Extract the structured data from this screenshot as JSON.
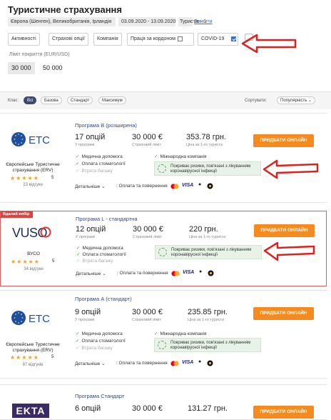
{
  "page": {
    "title": "Туристичне страхування"
  },
  "search": {
    "chips": [
      "Європа (Шенген), Великобританія, Ірландія",
      "03.09.2020 - 13.09.2020",
      "Туристів - 1"
    ],
    "change_label": "Змінити"
  },
  "filters": {
    "buttons": [
      "Активності",
      "Страхові опції",
      "Компанія"
    ],
    "checks": [
      {
        "label": "Праця за кордоном",
        "checked": false
      },
      {
        "label": "COVID-19",
        "checked": true
      }
    ]
  },
  "limit": {
    "label": "Ліміт покриття (EUR/USD)",
    "options": [
      "30 000",
      "50 000"
    ],
    "selected": "30 000"
  },
  "classbar": {
    "label": "Клас:",
    "pills": [
      "Всі",
      "Базова",
      "Стандарт",
      "Максимум"
    ],
    "sort_label": "Сортувати:",
    "sort_value": "Популярність"
  },
  "common": {
    "options_sub": "У програмі",
    "limit_sub": "Страховий ліміт",
    "price_sub": "Ціна за 1-го туриста",
    "buy_label": "ПРИДБАТИ ОНЛАЙН",
    "details_label": "Детальніше",
    "payment_label": "Оплата та повернення",
    "covid_text": "Покриває ризики, пов'язані з лікуванням коронавірусної інфекції",
    "badge": "Вдалий вибір"
  },
  "cards": [
    {
      "program": "Програма В (розширена)",
      "options": "17 опцій",
      "limit": "30 000 €",
      "price": "353.78 грн.",
      "logo": "ETC",
      "brand": "Європейське Туристичне страхування (ERV)",
      "rating": "5",
      "reviews": "23 відгуки",
      "features": [
        {
          "text": "Медична допомога",
          "on": true
        },
        {
          "text": "Оплата стоматології",
          "on": true
        },
        {
          "text": "Втрата багажу",
          "on": false
        },
        {
          "text": "Міжнародна компанія",
          "on": true
        }
      ]
    },
    {
      "program": "Програма L - стандартна",
      "options": "12 опцій",
      "limit": "30 000 €",
      "price": "220 грн.",
      "logo": "VUSO",
      "brand": "ВУСО",
      "rating": "5",
      "reviews": "34 відгуки",
      "features": [
        {
          "text": "Медична допомога",
          "on": true
        },
        {
          "text": "Оплата стоматології",
          "on": true
        },
        {
          "text": "Втрата багажу",
          "on": false
        }
      ]
    },
    {
      "program": "Програма А (стандарт)",
      "options": "9 опцій",
      "limit": "30 000 €",
      "price": "235.85 грн.",
      "logo": "ETC",
      "brand": "Європейське Туристичне страхування (ERV)",
      "rating": "5",
      "reviews": "87 відгуків",
      "features": [
        {
          "text": "Медична допомога",
          "on": true
        },
        {
          "text": "Оплата стоматології",
          "on": true
        },
        {
          "text": "Втрата багажу",
          "on": false
        },
        {
          "text": "Міжнародна компанія",
          "on": true
        }
      ]
    },
    {
      "program": "Програма Стандарт",
      "options": "6 опцій",
      "limit": "30 000 €",
      "price": "131.27 грн.",
      "logo": "EKTA"
    }
  ],
  "payment_icons": [
    "mastercard-icon",
    "VISA",
    "apple-icon",
    "google-pay-icon"
  ],
  "colors": {
    "accent": "#f58a1f",
    "link": "#2f4a8a",
    "annotation": "#e0201e",
    "success": "#3ba34a"
  }
}
